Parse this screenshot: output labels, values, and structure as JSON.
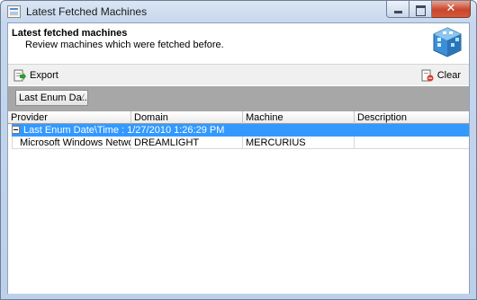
{
  "window": {
    "title": "Latest Fetched Machines"
  },
  "header": {
    "title": "Latest fetched machines",
    "subtitle": "Review machines which were fetched before.",
    "icon": "network-cube-icon"
  },
  "toolbar": {
    "export_label": "Export",
    "clear_label": "Clear"
  },
  "group_panel": {
    "group_by_chip": "Last Enum Da...",
    "sort_indicator": "⁄"
  },
  "grid": {
    "columns": [
      "Provider",
      "Domain",
      "Machine",
      "Description"
    ],
    "groups": [
      {
        "label": "Last Enum Date\\Time : 1/27/2010 1:26:29 PM",
        "rows": [
          [
            "Microsoft Windows Network",
            "DREAMLIGHT",
            "MERCURIUS",
            ""
          ]
        ]
      }
    ]
  },
  "colors": {
    "selection": "#3399ff",
    "group_panel": "#a7a7a7"
  }
}
